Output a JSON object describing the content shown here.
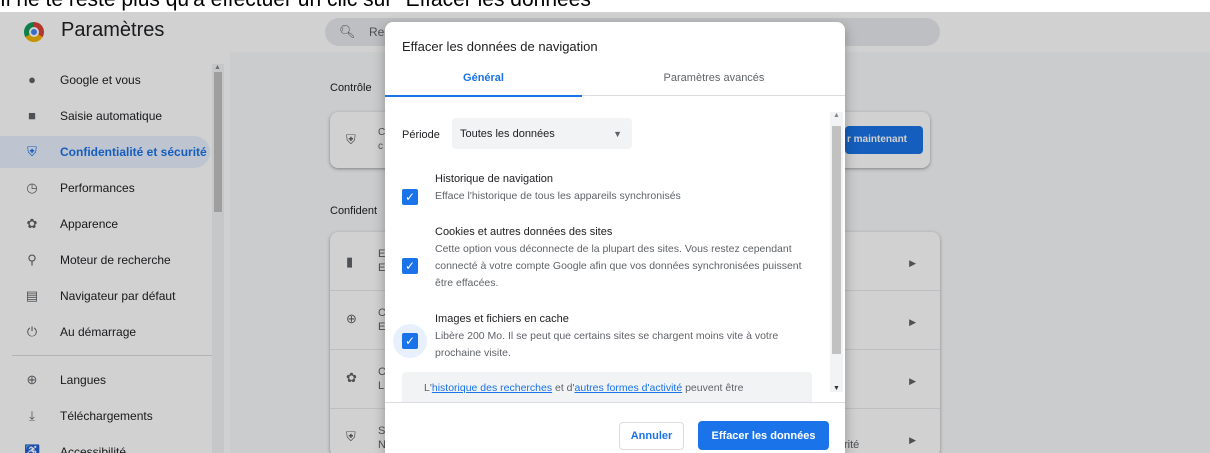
{
  "caption": "Il ne te reste plus qu'à effectuer un clic sur \"Effacer les données\"",
  "header": {
    "title": "Paramètres",
    "search_placeholder": "Re"
  },
  "sidebar": {
    "items": [
      {
        "label": "Google et vous",
        "icon": "person-icon"
      },
      {
        "label": "Saisie automatique",
        "icon": "clipboard-icon"
      },
      {
        "label": "Confidentialité et sécurité",
        "icon": "shield-icon",
        "active": true
      },
      {
        "label": "Performances",
        "icon": "speedometer-icon"
      },
      {
        "label": "Apparence",
        "icon": "palette-icon"
      },
      {
        "label": "Moteur de recherche",
        "icon": "search-icon"
      },
      {
        "label": "Navigateur par défaut",
        "icon": "browser-icon"
      },
      {
        "label": "Au démarrage",
        "icon": "power-icon"
      },
      {
        "label": "Langues",
        "icon": "globe-icon"
      },
      {
        "label": "Téléchargements",
        "icon": "download-icon"
      },
      {
        "label": "Accessibilité",
        "icon": "accessibility-icon"
      }
    ]
  },
  "main": {
    "section1": "Contrôle",
    "section2": "Confident",
    "card1_text": "C\nc",
    "primary_button": "r maintenant",
    "rows": [
      {
        "letter": "E",
        "sub": "E",
        "icon": "trash-icon"
      },
      {
        "letter": "C",
        "sub": "E",
        "icon": "cookie-plus-icon"
      },
      {
        "letter": "C",
        "sub": "L",
        "icon": "cookie-icon"
      },
      {
        "letter": "S",
        "sub": "N",
        "icon": "shield-icon",
        "tail": "rité"
      }
    ]
  },
  "dialog": {
    "title": "Effacer les données de navigation",
    "tabs": {
      "general": "Général",
      "advanced": "Paramètres avancés"
    },
    "period": {
      "label": "Période",
      "value": "Toutes les données"
    },
    "options": [
      {
        "title": "Historique de navigation",
        "desc": "Efface l'historique de tous les appareils synchronisés",
        "checked": true
      },
      {
        "title": "Cookies et autres données des sites",
        "desc": "Cette option vous déconnecte de la plupart des sites. Vous restez cependant connecté à votre compte Google afin que vos données synchronisées puissent être effacées.",
        "checked": true
      },
      {
        "title": "Images et fichiers en cache",
        "desc": "Libère 200 Mo. Il se peut que certains sites se chargent moins vite à votre prochaine visite.",
        "checked": true
      }
    ],
    "info": {
      "prefix": "L'",
      "link1": "historique des recherches",
      "middle": " et d'",
      "link2": "autres formes d'activité",
      "suffix": " peuvent être"
    },
    "buttons": {
      "cancel": "Annuler",
      "clear": "Effacer les données"
    }
  },
  "colors": {
    "accent": "#1a73e8",
    "active_bg": "#e8f0fe"
  }
}
